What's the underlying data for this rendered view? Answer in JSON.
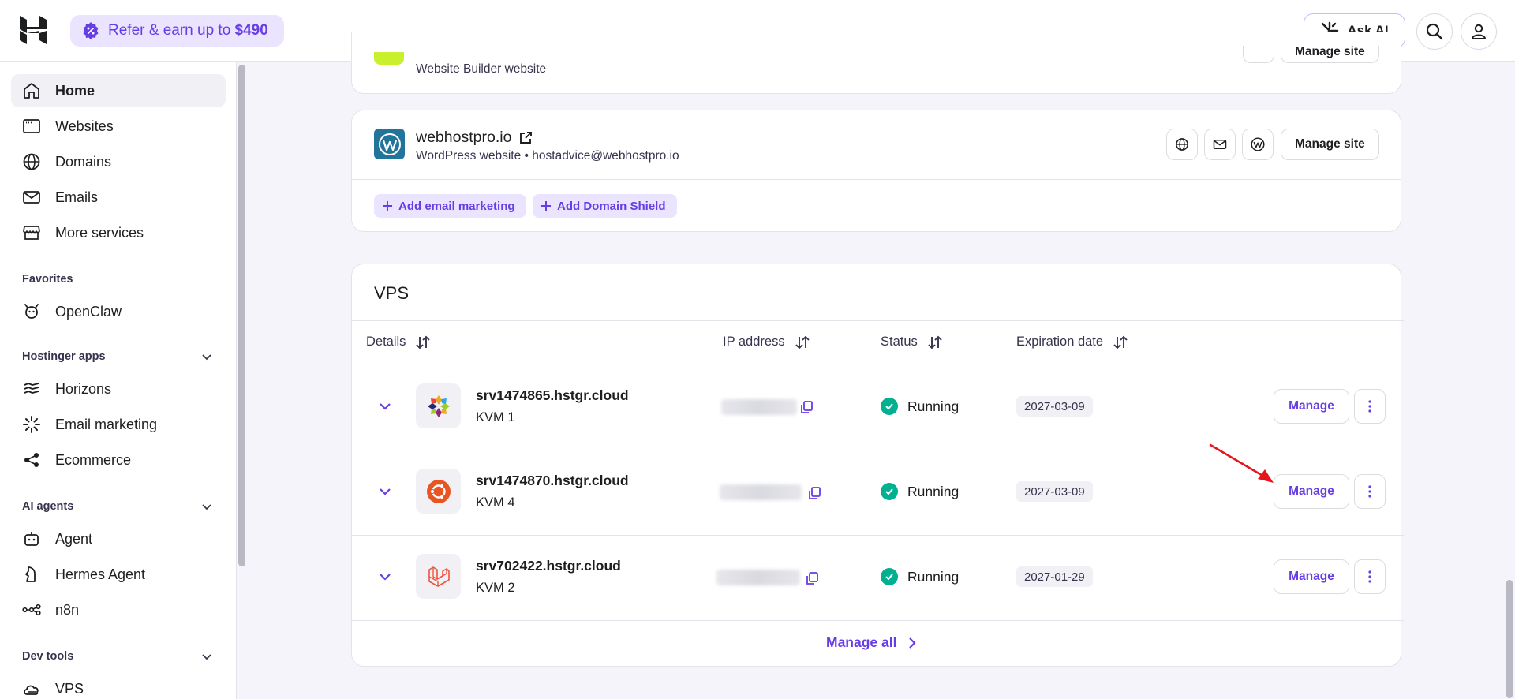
{
  "header": {
    "refer_label": "Refer & earn up to ",
    "refer_amount": "$490",
    "ask_ai_label": "Ask AI"
  },
  "sidebar": {
    "items": [
      {
        "label": "Home",
        "icon": "home-icon"
      },
      {
        "label": "Websites",
        "icon": "browser-icon"
      },
      {
        "label": "Domains",
        "icon": "globe-icon"
      },
      {
        "label": "Emails",
        "icon": "mail-icon"
      },
      {
        "label": "More services",
        "icon": "store-icon"
      }
    ],
    "favorites_label": "Favorites",
    "favorites": [
      {
        "label": "OpenClaw",
        "icon": "claw-icon"
      }
    ],
    "hostinger_apps_label": "Hostinger apps",
    "apps": [
      {
        "label": "Horizons",
        "icon": "horizons-icon"
      },
      {
        "label": "Email marketing",
        "icon": "spark-icon"
      },
      {
        "label": "Ecommerce",
        "icon": "share-nodes-icon"
      }
    ],
    "ai_agents_label": "AI agents",
    "agents": [
      {
        "label": "Agent",
        "icon": "agent-icon"
      },
      {
        "label": "Hermes Agent",
        "icon": "hermes-icon"
      },
      {
        "label": "n8n",
        "icon": "n8n-icon"
      }
    ],
    "dev_tools_label": "Dev tools",
    "dev_tools": [
      {
        "label": "VPS",
        "icon": "cloud-icon"
      }
    ]
  },
  "websites": {
    "builder_site": {
      "subtitle": "Website Builder website",
      "manage_label": "Manage site"
    },
    "wp_site": {
      "domain": "webhostpro.io",
      "subtitle": "WordPress website • hostadvice@webhostpro.io",
      "manage_label": "Manage site",
      "add_email_marketing": "Add email marketing",
      "add_domain_shield": "Add Domain Shield"
    }
  },
  "vps": {
    "title": "VPS",
    "columns": {
      "details": "Details",
      "ip": "IP address",
      "status": "Status",
      "expiration": "Expiration date"
    },
    "rows": [
      {
        "name": "srv1474865.hstgr.cloud",
        "plan": "KVM 1",
        "status": "Running",
        "expiration": "2027-03-09",
        "os_icon": "centos-icon",
        "manage": "Manage"
      },
      {
        "name": "srv1474870.hstgr.cloud",
        "plan": "KVM 4",
        "status": "Running",
        "expiration": "2027-03-09",
        "os_icon": "ubuntu-icon",
        "manage": "Manage"
      },
      {
        "name": "srv702422.hstgr.cloud",
        "plan": "KVM 2",
        "status": "Running",
        "expiration": "2027-01-29",
        "os_icon": "laravel-icon",
        "manage": "Manage"
      }
    ],
    "manage_all": "Manage all"
  },
  "colors": {
    "brand": "#673de6",
    "running": "#00b090",
    "annotation_arrow": "#e8141b"
  }
}
